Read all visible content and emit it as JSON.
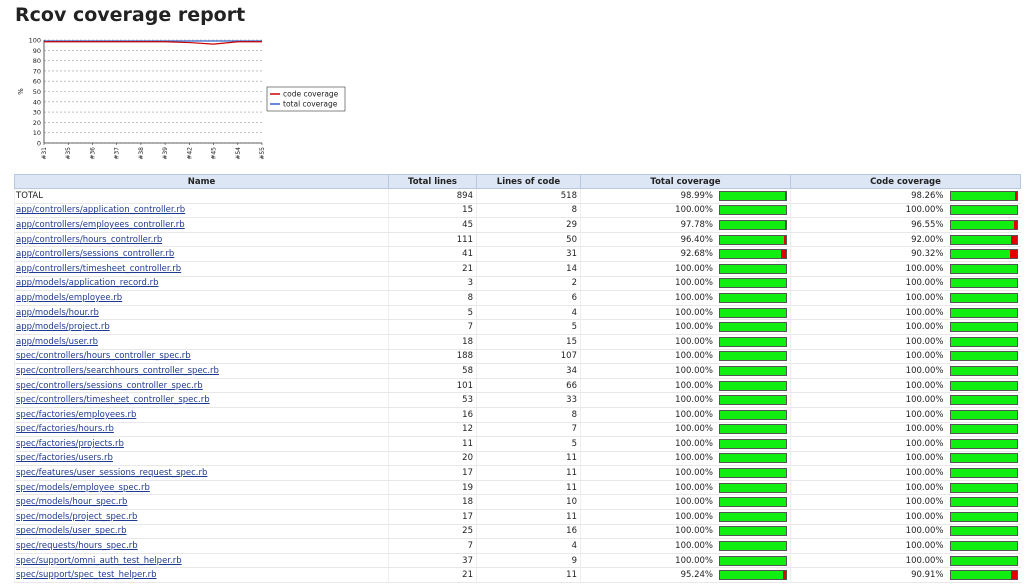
{
  "page": {
    "title": "Rcov coverage report"
  },
  "chart_data": {
    "type": "line",
    "x": [
      "#31",
      "#35",
      "#36",
      "#37",
      "#38",
      "#39",
      "#42",
      "#45",
      "#54",
      "#55"
    ],
    "series": [
      {
        "name": "code coverage",
        "color": "#cc0000",
        "values": [
          98.3,
          98.3,
          98.3,
          98.3,
          98.3,
          98.3,
          97.5,
          96.0,
          98.3,
          98.3
        ]
      },
      {
        "name": "total coverage",
        "color": "#3366cc",
        "values": [
          99.0,
          99.0,
          99.0,
          99.0,
          99.0,
          99.0,
          99.0,
          99.0,
          99.0,
          99.0
        ]
      }
    ],
    "ylabel": "%",
    "ylim": [
      0,
      100
    ],
    "yticks": [
      "0",
      "10",
      "20",
      "30",
      "40",
      "50",
      "60",
      "70",
      "80",
      "90",
      "100"
    ],
    "grid": true,
    "legend": "right"
  },
  "table": {
    "headers": [
      "Name",
      "Total lines",
      "Lines of code",
      "Total coverage",
      "Code coverage"
    ],
    "rows": [
      {
        "name": "TOTAL",
        "link": false,
        "total_lines": "894",
        "loc": "518",
        "total_cov": "98.99%",
        "total_pct": 98.99,
        "code_cov": "98.26%",
        "code_pct": 98.26
      },
      {
        "name": "app/controllers/application_controller.rb",
        "link": true,
        "total_lines": "15",
        "loc": "8",
        "total_cov": "100.00%",
        "total_pct": 100,
        "code_cov": "100.00%",
        "code_pct": 100
      },
      {
        "name": "app/controllers/employees_controller.rb",
        "link": true,
        "total_lines": "45",
        "loc": "29",
        "total_cov": "97.78%",
        "total_pct": 97.78,
        "code_cov": "96.55%",
        "code_pct": 96.55
      },
      {
        "name": "app/controllers/hours_controller.rb",
        "link": true,
        "total_lines": "111",
        "loc": "50",
        "total_cov": "96.40%",
        "total_pct": 96.4,
        "code_cov": "92.00%",
        "code_pct": 92.0
      },
      {
        "name": "app/controllers/sessions_controller.rb",
        "link": true,
        "total_lines": "41",
        "loc": "31",
        "total_cov": "92.68%",
        "total_pct": 92.68,
        "code_cov": "90.32%",
        "code_pct": 90.32
      },
      {
        "name": "app/controllers/timesheet_controller.rb",
        "link": true,
        "total_lines": "21",
        "loc": "14",
        "total_cov": "100.00%",
        "total_pct": 100,
        "code_cov": "100.00%",
        "code_pct": 100
      },
      {
        "name": "app/models/application_record.rb",
        "link": true,
        "total_lines": "3",
        "loc": "2",
        "total_cov": "100.00%",
        "total_pct": 100,
        "code_cov": "100.00%",
        "code_pct": 100
      },
      {
        "name": "app/models/employee.rb",
        "link": true,
        "total_lines": "8",
        "loc": "6",
        "total_cov": "100.00%",
        "total_pct": 100,
        "code_cov": "100.00%",
        "code_pct": 100
      },
      {
        "name": "app/models/hour.rb",
        "link": true,
        "total_lines": "5",
        "loc": "4",
        "total_cov": "100.00%",
        "total_pct": 100,
        "code_cov": "100.00%",
        "code_pct": 100
      },
      {
        "name": "app/models/project.rb",
        "link": true,
        "total_lines": "7",
        "loc": "5",
        "total_cov": "100.00%",
        "total_pct": 100,
        "code_cov": "100.00%",
        "code_pct": 100
      },
      {
        "name": "app/models/user.rb",
        "link": true,
        "total_lines": "18",
        "loc": "15",
        "total_cov": "100.00%",
        "total_pct": 100,
        "code_cov": "100.00%",
        "code_pct": 100
      },
      {
        "name": "spec/controllers/hours_controller_spec.rb",
        "link": true,
        "total_lines": "188",
        "loc": "107",
        "total_cov": "100.00%",
        "total_pct": 100,
        "code_cov": "100.00%",
        "code_pct": 100
      },
      {
        "name": "spec/controllers/searchhours_controller_spec.rb",
        "link": true,
        "total_lines": "58",
        "loc": "34",
        "total_cov": "100.00%",
        "total_pct": 100,
        "code_cov": "100.00%",
        "code_pct": 100
      },
      {
        "name": "spec/controllers/sessions_controller_spec.rb",
        "link": true,
        "total_lines": "101",
        "loc": "66",
        "total_cov": "100.00%",
        "total_pct": 100,
        "code_cov": "100.00%",
        "code_pct": 100
      },
      {
        "name": "spec/controllers/timesheet_controller_spec.rb",
        "link": true,
        "total_lines": "53",
        "loc": "33",
        "total_cov": "100.00%",
        "total_pct": 100,
        "code_cov": "100.00%",
        "code_pct": 100
      },
      {
        "name": "spec/factories/employees.rb",
        "link": true,
        "total_lines": "16",
        "loc": "8",
        "total_cov": "100.00%",
        "total_pct": 100,
        "code_cov": "100.00%",
        "code_pct": 100
      },
      {
        "name": "spec/factories/hours.rb",
        "link": true,
        "total_lines": "12",
        "loc": "7",
        "total_cov": "100.00%",
        "total_pct": 100,
        "code_cov": "100.00%",
        "code_pct": 100
      },
      {
        "name": "spec/factories/projects.rb",
        "link": true,
        "total_lines": "11",
        "loc": "5",
        "total_cov": "100.00%",
        "total_pct": 100,
        "code_cov": "100.00%",
        "code_pct": 100
      },
      {
        "name": "spec/factories/users.rb",
        "link": true,
        "total_lines": "20",
        "loc": "11",
        "total_cov": "100.00%",
        "total_pct": 100,
        "code_cov": "100.00%",
        "code_pct": 100
      },
      {
        "name": "spec/features/user_sessions_request_spec.rb",
        "link": true,
        "total_lines": "17",
        "loc": "11",
        "total_cov": "100.00%",
        "total_pct": 100,
        "code_cov": "100.00%",
        "code_pct": 100
      },
      {
        "name": "spec/models/employee_spec.rb",
        "link": true,
        "total_lines": "19",
        "loc": "11",
        "total_cov": "100.00%",
        "total_pct": 100,
        "code_cov": "100.00%",
        "code_pct": 100
      },
      {
        "name": "spec/models/hour_spec.rb",
        "link": true,
        "total_lines": "18",
        "loc": "10",
        "total_cov": "100.00%",
        "total_pct": 100,
        "code_cov": "100.00%",
        "code_pct": 100
      },
      {
        "name": "spec/models/project_spec.rb",
        "link": true,
        "total_lines": "17",
        "loc": "11",
        "total_cov": "100.00%",
        "total_pct": 100,
        "code_cov": "100.00%",
        "code_pct": 100
      },
      {
        "name": "spec/models/user_spec.rb",
        "link": true,
        "total_lines": "25",
        "loc": "16",
        "total_cov": "100.00%",
        "total_pct": 100,
        "code_cov": "100.00%",
        "code_pct": 100
      },
      {
        "name": "spec/requests/hours_spec.rb",
        "link": true,
        "total_lines": "7",
        "loc": "4",
        "total_cov": "100.00%",
        "total_pct": 100,
        "code_cov": "100.00%",
        "code_pct": 100
      },
      {
        "name": "spec/support/omni_auth_test_helper.rb",
        "link": true,
        "total_lines": "37",
        "loc": "9",
        "total_cov": "100.00%",
        "total_pct": 100,
        "code_cov": "100.00%",
        "code_pct": 100
      },
      {
        "name": "spec/support/spec_test_helper.rb",
        "link": true,
        "total_lines": "21",
        "loc": "11",
        "total_cov": "95.24%",
        "total_pct": 95.24,
        "code_cov": "90.91%",
        "code_pct": 90.91
      }
    ]
  },
  "colors": {
    "bar_covered": "#11ee11",
    "bar_uncovered": "#e00000",
    "header_bg": "#dce6f5",
    "link": "#1f3a93"
  }
}
